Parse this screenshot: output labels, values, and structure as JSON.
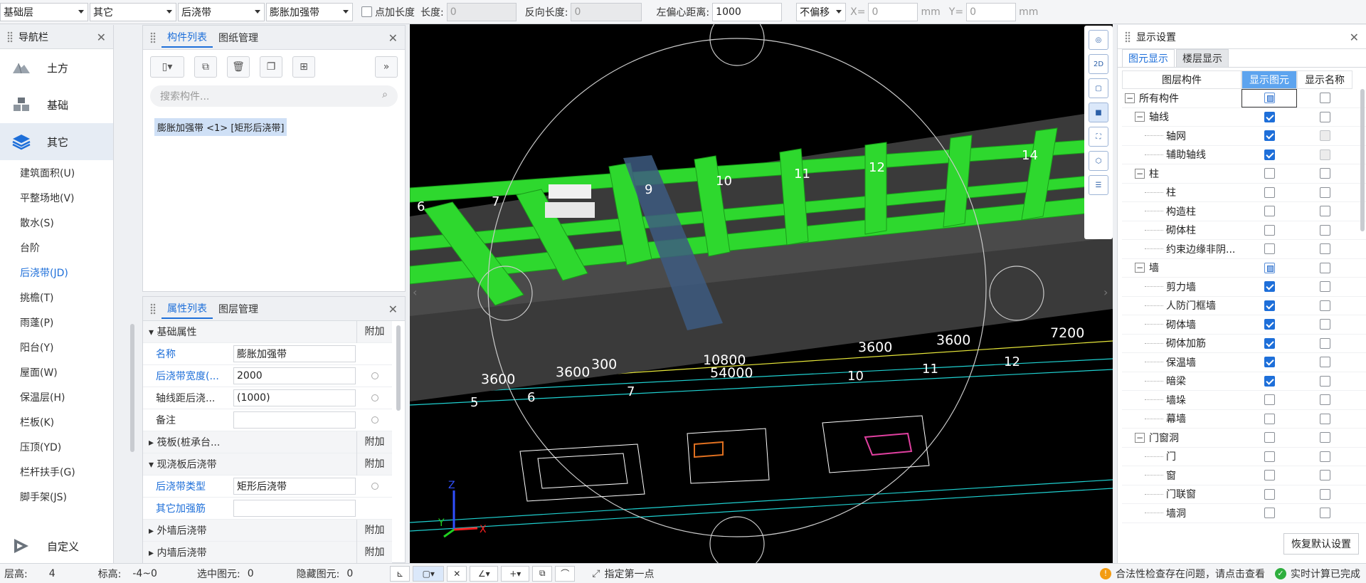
{
  "toolbar": {
    "floor": "基础层",
    "category": "其它",
    "component_type": "后浇带",
    "component": "膨胀加强带",
    "point_length_label": "点加长度",
    "length_label": "长度:",
    "length_value": "0",
    "reverse_length_label": "反向长度:",
    "reverse_length_value": "0",
    "left_offset_label": "左偏心距离:",
    "left_offset_value": "1000",
    "offset_mode": "不偏移",
    "x_label": "X=",
    "x_value": "0",
    "x_unit": "mm",
    "y_label": "Y=",
    "y_value": "0",
    "y_unit": "mm"
  },
  "nav": {
    "title": "导航栏",
    "big_items": [
      {
        "label": "土方",
        "icon": "earthwork-icon"
      },
      {
        "label": "基础",
        "icon": "foundation-icon"
      },
      {
        "label": "其它",
        "icon": "layers-icon"
      }
    ],
    "items": [
      "建筑面积(U)",
      "平整场地(V)",
      "散水(S)",
      "台阶",
      "后浇带(JD)",
      "挑檐(T)",
      "雨蓬(P)",
      "阳台(Y)",
      "屋面(W)",
      "保温层(H)",
      "栏板(K)",
      "压顶(YD)",
      "栏杆扶手(G)",
      "脚手架(JS)"
    ],
    "custom": "自定义"
  },
  "comp_panel": {
    "tab1": "构件列表",
    "tab2": "图纸管理",
    "search_placeholder": "搜索构件...",
    "item": "膨胀加强带 <1> [矩形后浇带]"
  },
  "prop_panel": {
    "tab1": "属性列表",
    "tab2": "图层管理",
    "g1": "基础属性",
    "add": "附加",
    "rows": [
      {
        "k": "名称",
        "v": "膨胀加强带"
      },
      {
        "k": "后浇带宽度(...",
        "v": "2000"
      },
      {
        "k": "轴线距后浇...",
        "v": "(1000)"
      },
      {
        "k": "备注",
        "v": ""
      }
    ],
    "g2": "筏板(桩承台...",
    "g3": "现浇板后浇带",
    "rows2": [
      {
        "k": "后浇带类型",
        "v": "矩形后浇带"
      },
      {
        "k": "其它加强筋",
        "v": ""
      }
    ],
    "g4": "外墙后浇带",
    "g5": "内墙后浇带"
  },
  "viewport": {
    "axis_numbers": [
      "5",
      "6",
      "7",
      "10",
      "11",
      "12",
      "6",
      "7",
      "9",
      "10",
      "11",
      "12",
      "14"
    ],
    "dims": [
      "3600",
      "3600",
      "300",
      "10800",
      "54000",
      "3600",
      "3600",
      "7200"
    ]
  },
  "display": {
    "title": "显示设置",
    "tab1": "图元显示",
    "tab2": "楼层显示",
    "col1": "图层构件",
    "col2": "显示图元",
    "col3": "显示名称",
    "rows": [
      {
        "n": "所有构件",
        "lvl": 0,
        "tg": "−",
        "c1": "part",
        "c2": "off"
      },
      {
        "n": "轴线",
        "lvl": 1,
        "tg": "−",
        "c1": "on",
        "c2": "off"
      },
      {
        "n": "轴网",
        "lvl": 2,
        "c1": "on",
        "c2": "gray"
      },
      {
        "n": "辅助轴线",
        "lvl": 2,
        "c1": "on",
        "c2": "gray"
      },
      {
        "n": "柱",
        "lvl": 1,
        "tg": "−",
        "c1": "off",
        "c2": "off"
      },
      {
        "n": "柱",
        "lvl": 2,
        "c1": "off",
        "c2": "off"
      },
      {
        "n": "构造柱",
        "lvl": 2,
        "c1": "off",
        "c2": "off"
      },
      {
        "n": "砌体柱",
        "lvl": 2,
        "c1": "off",
        "c2": "off"
      },
      {
        "n": "约束边缘非阴...",
        "lvl": 2,
        "c1": "off",
        "c2": "off"
      },
      {
        "n": "墙",
        "lvl": 1,
        "tg": "−",
        "c1": "part",
        "c2": "off"
      },
      {
        "n": "剪力墙",
        "lvl": 2,
        "c1": "on",
        "c2": "off"
      },
      {
        "n": "人防门框墙",
        "lvl": 2,
        "c1": "on",
        "c2": "off"
      },
      {
        "n": "砌体墙",
        "lvl": 2,
        "c1": "on",
        "c2": "off"
      },
      {
        "n": "砌体加筋",
        "lvl": 2,
        "c1": "on",
        "c2": "off"
      },
      {
        "n": "保温墙",
        "lvl": 2,
        "c1": "on",
        "c2": "off"
      },
      {
        "n": "暗梁",
        "lvl": 2,
        "c1": "on",
        "c2": "off"
      },
      {
        "n": "墙垛",
        "lvl": 2,
        "c1": "off",
        "c2": "off"
      },
      {
        "n": "幕墙",
        "lvl": 2,
        "c1": "off",
        "c2": "off"
      },
      {
        "n": "门窗洞",
        "lvl": 1,
        "tg": "−",
        "c1": "off",
        "c2": "off"
      },
      {
        "n": "门",
        "lvl": 2,
        "c1": "off",
        "c2": "off"
      },
      {
        "n": "窗",
        "lvl": 2,
        "c1": "off",
        "c2": "off"
      },
      {
        "n": "门联窗",
        "lvl": 2,
        "c1": "off",
        "c2": "off"
      },
      {
        "n": "墙洞",
        "lvl": 2,
        "c1": "off",
        "c2": "off"
      }
    ],
    "restore": "恢复默认设置"
  },
  "status": {
    "floor_height_label": "层高:",
    "floor_height": "4",
    "elevation_label": "标高:",
    "elevation": "-4~0",
    "selected_label": "选中图元:",
    "selected": "0",
    "hidden_label": "隐藏图元:",
    "hidden": "0",
    "prompt": "指定第一点",
    "legality": "合法性检查存在问题，请点击查看",
    "realtime": "实时计算已完成"
  }
}
